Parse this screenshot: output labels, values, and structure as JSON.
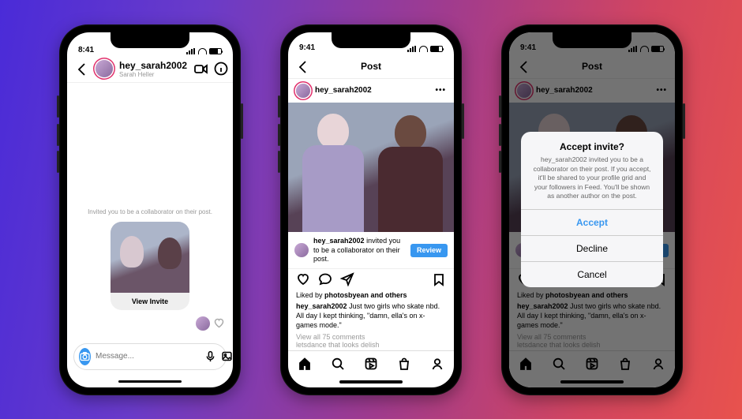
{
  "status": {
    "time1": "8:41",
    "time2": "9:41",
    "time3": "9:41"
  },
  "phone1": {
    "username": "hey_sarah2002",
    "realname": "Sarah Heller",
    "invite_text": "Invited you to be a collaborator on their post.",
    "view_invite": "View Invite",
    "placeholder": "Message..."
  },
  "phone2": {
    "title": "Post",
    "username": "hey_sarah2002",
    "collab_user": "hey_sarah2002",
    "collab_rest": " invited you to be a collaborator on their post.",
    "review": "Review",
    "liked_by_pre": "Liked by ",
    "liked_by_user": "photosbyean",
    "liked_by_rest": " and others",
    "cap_user": "hey_sarah2002",
    "cap_rest": " Just two girls who skate nbd. All day I kept thinking, \"damn, ella's on x-games mode.\"",
    "view_comments": "View all 75 comments",
    "truncated": "letsdance that looks delish"
  },
  "phone3": {
    "title": "Post",
    "alert_title": "Accept invite?",
    "alert_body": "hey_sarah2002 invited you to be a collaborator on their post. If you accept, it'll be shared to your profile grid and your followers in Feed. You'll be shown as another author on the post.",
    "accept": "Accept",
    "decline": "Decline",
    "cancel": "Cancel"
  }
}
